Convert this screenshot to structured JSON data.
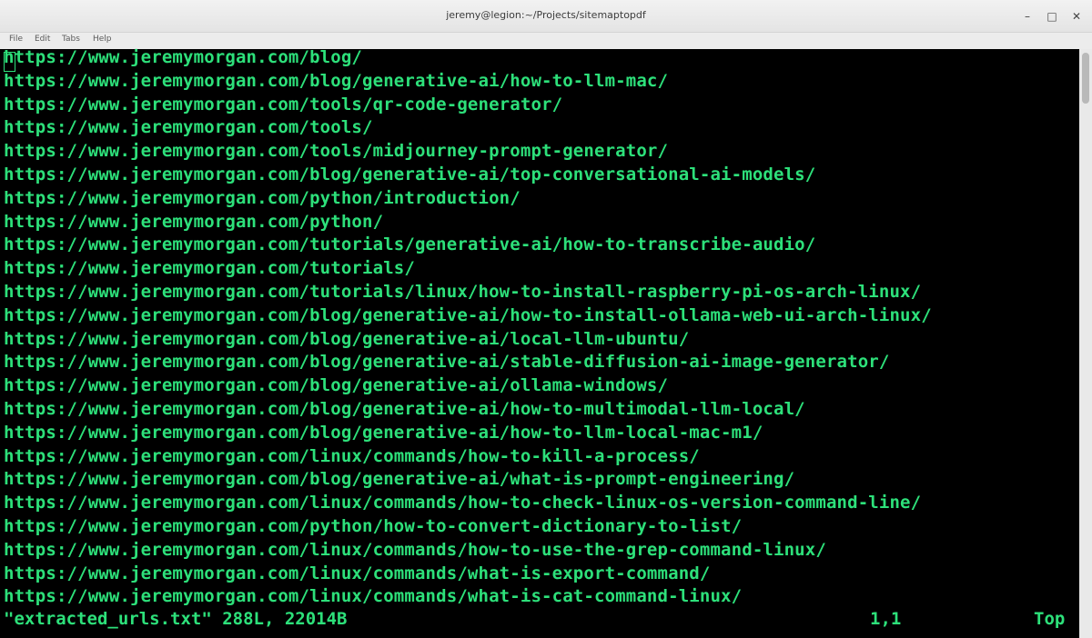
{
  "window": {
    "title": "jeremy@legion:~/Projects/sitemaptopdf",
    "minimize_glyph": "–",
    "maximize_glyph": "□",
    "close_glyph": "✕"
  },
  "menu": [
    "File",
    "Edit",
    "Tabs",
    "Help"
  ],
  "lines": [
    "https://www.jeremymorgan.com/blog/",
    "https://www.jeremymorgan.com/blog/generative-ai/how-to-llm-mac/",
    "https://www.jeremymorgan.com/tools/qr-code-generator/",
    "https://www.jeremymorgan.com/tools/",
    "https://www.jeremymorgan.com/tools/midjourney-prompt-generator/",
    "https://www.jeremymorgan.com/blog/generative-ai/top-conversational-ai-models/",
    "https://www.jeremymorgan.com/python/introduction/",
    "https://www.jeremymorgan.com/python/",
    "https://www.jeremymorgan.com/tutorials/generative-ai/how-to-transcribe-audio/",
    "https://www.jeremymorgan.com/tutorials/",
    "https://www.jeremymorgan.com/tutorials/linux/how-to-install-raspberry-pi-os-arch-linux/",
    "https://www.jeremymorgan.com/blog/generative-ai/how-to-install-ollama-web-ui-arch-linux/",
    "https://www.jeremymorgan.com/blog/generative-ai/local-llm-ubuntu/",
    "https://www.jeremymorgan.com/blog/generative-ai/stable-diffusion-ai-image-generator/",
    "https://www.jeremymorgan.com/blog/generative-ai/ollama-windows/",
    "https://www.jeremymorgan.com/blog/generative-ai/how-to-multimodal-llm-local/",
    "https://www.jeremymorgan.com/blog/generative-ai/how-to-llm-local-mac-m1/",
    "https://www.jeremymorgan.com/linux/commands/how-to-kill-a-process/",
    "https://www.jeremymorgan.com/blog/generative-ai/what-is-prompt-engineering/",
    "https://www.jeremymorgan.com/linux/commands/how-to-check-linux-os-version-command-line/",
    "https://www.jeremymorgan.com/python/how-to-convert-dictionary-to-list/",
    "https://www.jeremymorgan.com/linux/commands/how-to-use-the-grep-command-linux/",
    "https://www.jeremymorgan.com/linux/commands/what-is-export-command/",
    "https://www.jeremymorgan.com/linux/commands/what-is-cat-command-linux/"
  ],
  "status": {
    "file": "\"extracted_urls.txt\" 288L, 22014B",
    "position": "1,1",
    "scroll": "Top"
  },
  "colors": {
    "terminal_bg": "#000000",
    "text": "#2de07a"
  }
}
